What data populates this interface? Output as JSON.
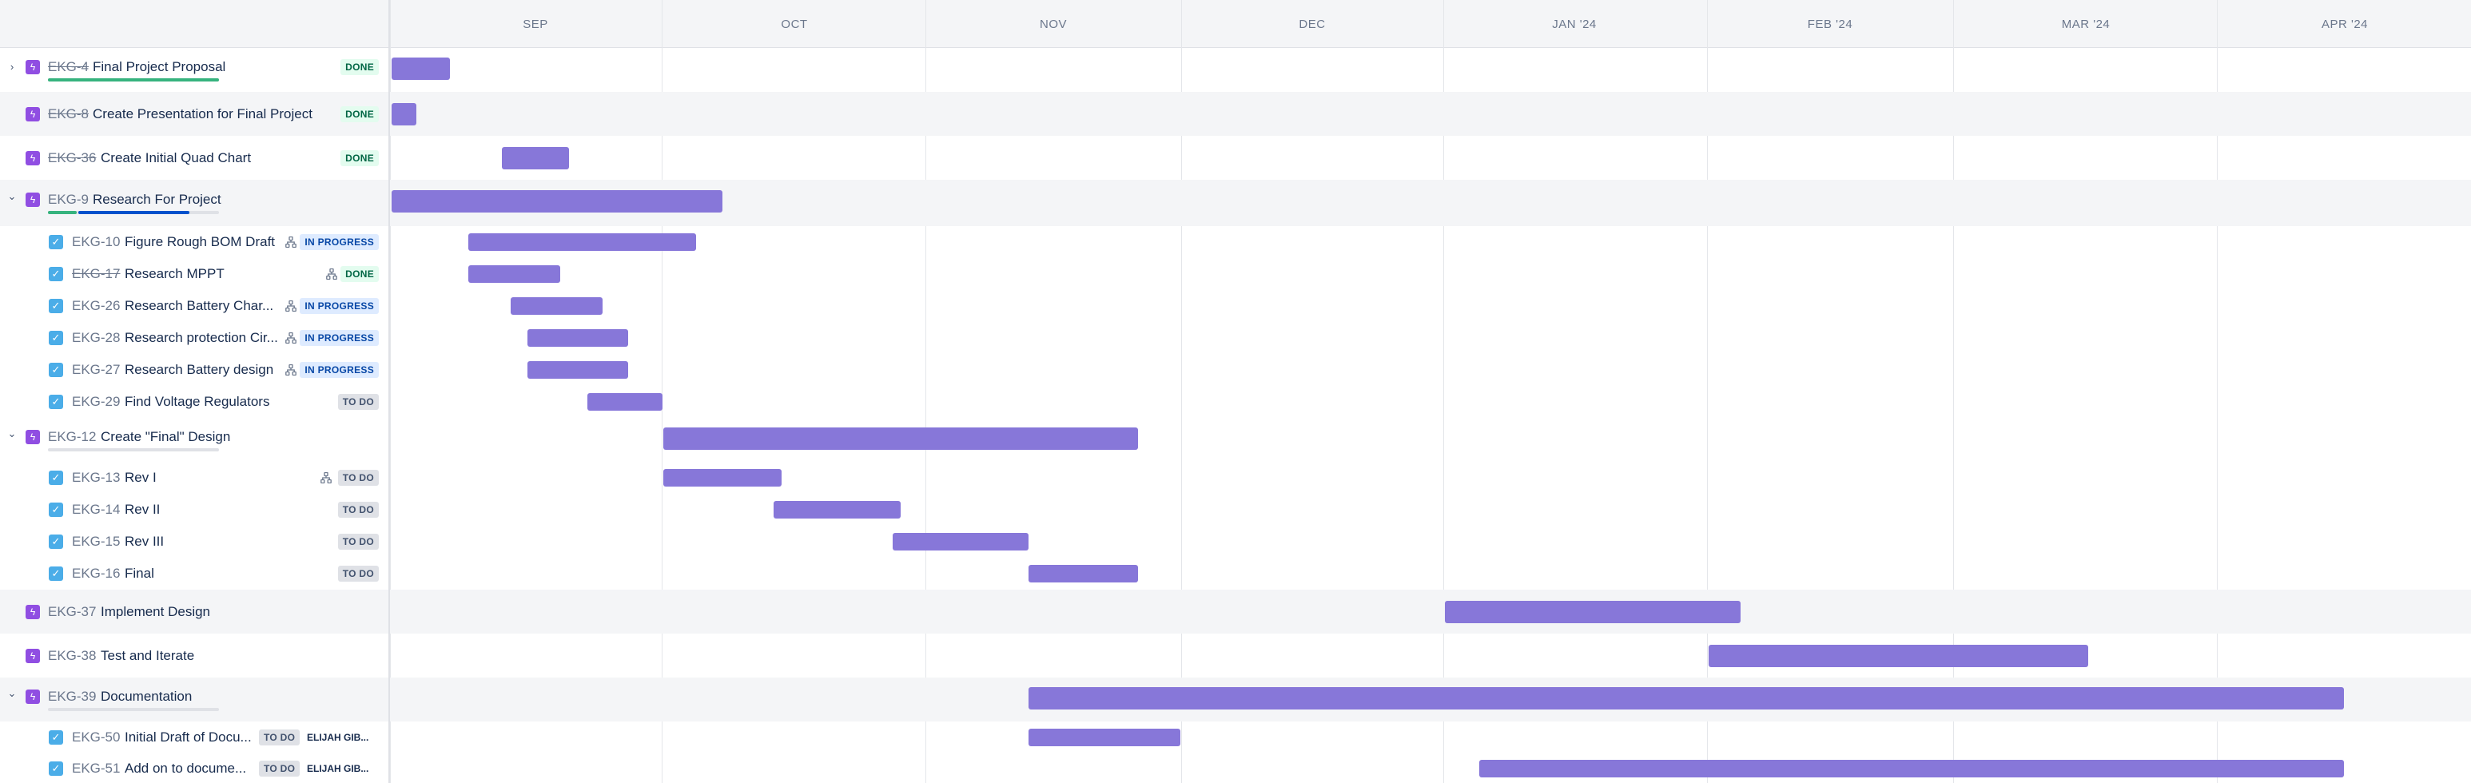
{
  "timeline": {
    "months": [
      "SEP",
      "OCT",
      "NOV",
      "DEC",
      "JAN '24",
      "FEB '24",
      "MAR '24",
      "APR '24"
    ]
  },
  "colors": {
    "epic": "#904ee2",
    "task": "#4bade8",
    "bar": "#8777d9",
    "done_progress": "#36b37e",
    "in_progress": "#0052cc",
    "todo_progress": "#c1c7d0"
  },
  "rows": [
    {
      "type": "epic",
      "key": "EKG-4",
      "summary": "Final Project Proposal",
      "status": "DONE",
      "done": true,
      "toggle": "collapsed",
      "progress": {
        "done": 1.0,
        "in_progress": 0.0
      }
    },
    {
      "type": "epic",
      "key": "EKG-8",
      "summary": "Create Presentation for Final Project",
      "status": "DONE",
      "done": true
    },
    {
      "type": "epic",
      "key": "EKG-36",
      "summary": "Create Initial Quad Chart",
      "status": "DONE",
      "done": true
    },
    {
      "type": "epic",
      "key": "EKG-9",
      "summary": "Research For Project",
      "done": false,
      "toggle": "expanded",
      "progress": {
        "done": 0.17,
        "in_progress": 0.66
      }
    },
    {
      "type": "child",
      "key": "EKG-10",
      "summary": "Figure Rough BOM Draft",
      "status": "IN PROGRESS",
      "done": false,
      "has_children": true
    },
    {
      "type": "child",
      "key": "EKG-17",
      "summary": "Research MPPT",
      "status": "DONE",
      "done": true,
      "has_children": true
    },
    {
      "type": "child",
      "key": "EKG-26",
      "summary": "Research Battery Char...",
      "status": "IN PROGRESS",
      "done": false,
      "has_children": true
    },
    {
      "type": "child",
      "key": "EKG-28",
      "summary": "Research protection Cir...",
      "status": "IN PROGRESS",
      "done": false,
      "has_children": true
    },
    {
      "type": "child",
      "key": "EKG-27",
      "summary": "Research Battery design",
      "status": "IN PROGRESS",
      "done": false,
      "has_children": true
    },
    {
      "type": "child",
      "key": "EKG-29",
      "summary": "Find Voltage Regulators",
      "status": "TO DO",
      "done": false
    },
    {
      "type": "epic",
      "key": "EKG-12",
      "summary": "Create \"Final\" Design",
      "done": false,
      "toggle": "expanded",
      "progress": {
        "done": 0.0,
        "in_progress": 0.0
      }
    },
    {
      "type": "child",
      "key": "EKG-13",
      "summary": "Rev I",
      "status": "TO DO",
      "done": false,
      "has_children": true
    },
    {
      "type": "child",
      "key": "EKG-14",
      "summary": "Rev II",
      "status": "TO DO",
      "done": false
    },
    {
      "type": "child",
      "key": "EKG-15",
      "summary": "Rev III",
      "status": "TO DO",
      "done": false
    },
    {
      "type": "child",
      "key": "EKG-16",
      "summary": "Final",
      "status": "TO DO",
      "done": false
    },
    {
      "type": "epic",
      "key": "EKG-37",
      "summary": "Implement Design",
      "done": false
    },
    {
      "type": "epic",
      "key": "EKG-38",
      "summary": "Test and Iterate",
      "done": false
    },
    {
      "type": "epic",
      "key": "EKG-39",
      "summary": "Documentation",
      "done": false,
      "toggle": "expanded",
      "progress": {
        "done": 0.0,
        "in_progress": 0.0
      }
    },
    {
      "type": "child",
      "key": "EKG-50",
      "summary": "Initial Draft of Docu...",
      "status": "TO DO",
      "done": false,
      "assignee": "ELIJAH GIB..."
    },
    {
      "type": "child",
      "key": "EKG-51",
      "summary": "Add on to docume...",
      "status": "TO DO",
      "done": false,
      "assignee": "ELIJAH GIB..."
    }
  ]
}
